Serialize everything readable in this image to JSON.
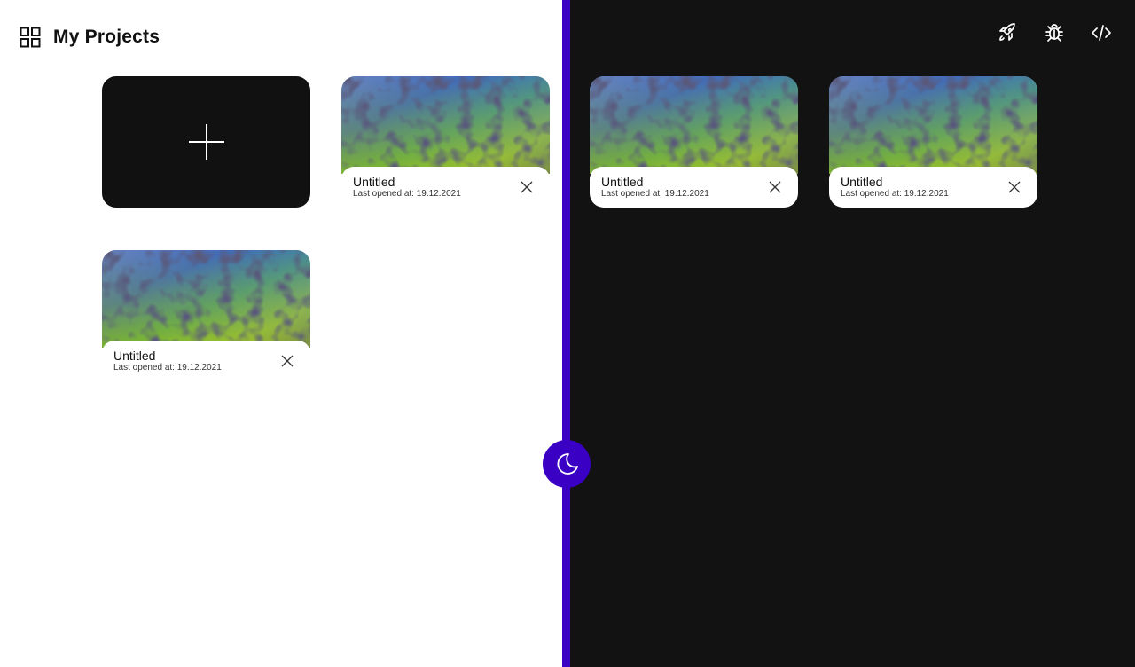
{
  "header": {
    "title": "My Projects",
    "icon": "grid-icon"
  },
  "top_actions": [
    {
      "icon": "rocket-icon"
    },
    {
      "icon": "bug-icon"
    },
    {
      "icon": "code-icon"
    }
  ],
  "new_project": {
    "icon": "plus-icon"
  },
  "projects": [
    {
      "name": "Untitled",
      "meta": "Last opened at: 19.12.2021"
    },
    {
      "name": "Untitled",
      "meta": "Last opened at: 19.12.2021"
    },
    {
      "name": "Untitled",
      "meta": "Last opened at: 19.12.2021"
    },
    {
      "name": "Untitled",
      "meta": "Last opened at: 19.12.2021"
    }
  ],
  "theme_toggle": {
    "icon": "moon-icon"
  },
  "colors": {
    "accent": "#3a00c4",
    "dark_panel": "#121212",
    "light_panel": "#ffffff"
  }
}
